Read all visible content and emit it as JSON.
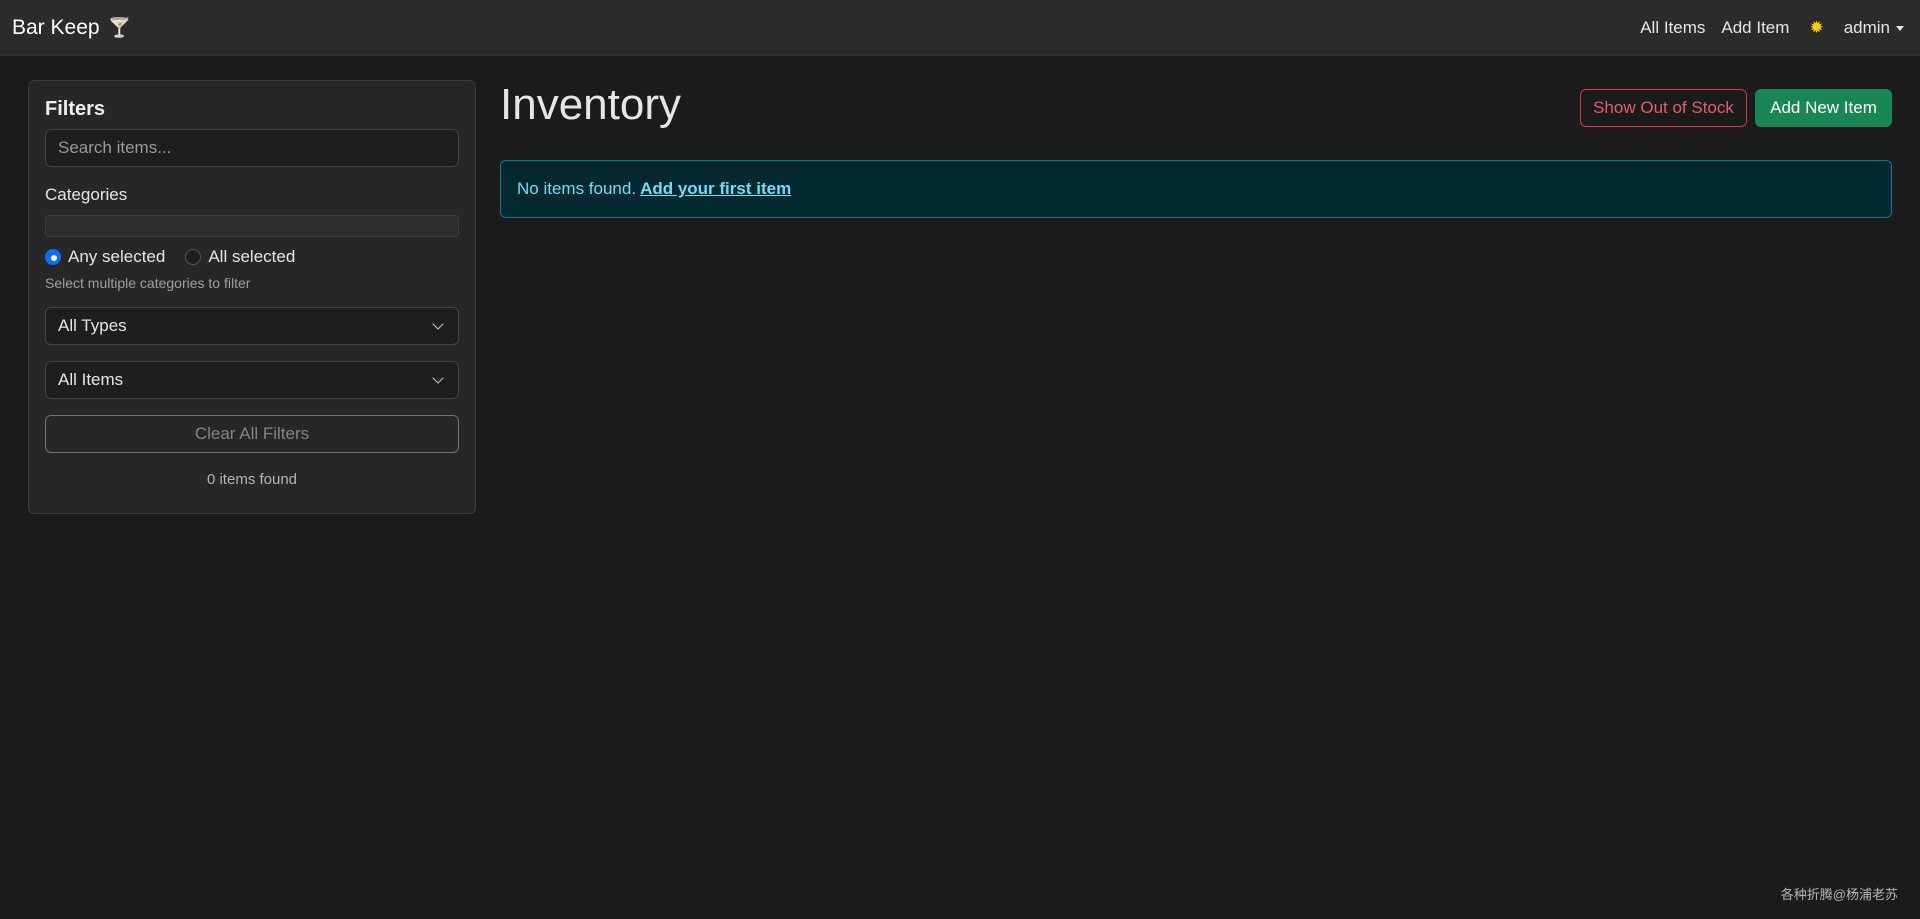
{
  "navbar": {
    "brand": "Bar Keep",
    "brand_icon": "cocktail-glass-icon",
    "links": [
      "All Items",
      "Add Item"
    ],
    "theme_icon": "sun-icon",
    "user": "admin"
  },
  "filters": {
    "title": "Filters",
    "search_placeholder": "Search items...",
    "search_value": "",
    "categories_label": "Categories",
    "match_options": [
      "Any selected",
      "All selected"
    ],
    "match_selected": "Any selected",
    "categories_help": "Select multiple categories to filter",
    "type_select": "All Types",
    "stock_select": "All Items",
    "clear_label": "Clear All Filters",
    "count_text": "0 items found"
  },
  "main": {
    "title": "Inventory",
    "show_out_of_stock_label": "Show Out of Stock",
    "add_new_label": "Add New Item",
    "empty_message": "No items found.",
    "empty_link": "Add your first item"
  },
  "watermark": "各种折腾@杨浦老苏",
  "colors": {
    "background": "#1b1b1b",
    "navbar": "#2b2b2b",
    "danger": "#dc3545",
    "success": "#198754",
    "info": "#6edff6",
    "primary": "#0d6efd"
  }
}
